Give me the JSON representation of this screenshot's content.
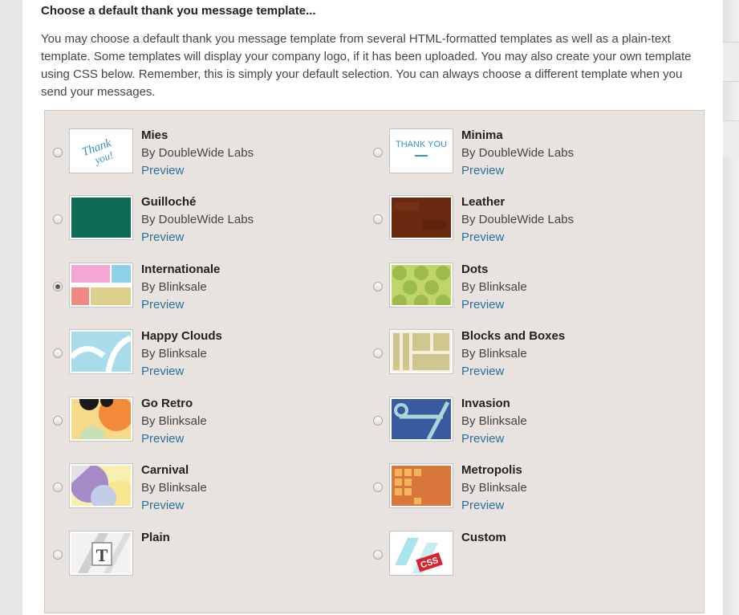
{
  "section": {
    "heading": "Choose a default thank you message template...",
    "description": "You may choose a default thank you message template from several HTML-formatted templates as well as a plain-text template. Some templates will display your company logo, if it has been uploaded. You may also create your own template using CSS below. Remember, this is simply your default selection. You can always choose a different template when you send your messages."
  },
  "templates": [
    {
      "name": "Mies",
      "author": "By DoubleWide Labs",
      "preview": "Preview",
      "selected": false,
      "thumb": "thank-you-script-icon"
    },
    {
      "name": "Minima",
      "author": "By DoubleWide Labs",
      "preview": "Preview",
      "selected": false,
      "thumb": "thank-you-minimal-icon"
    },
    {
      "name": "Guilloché",
      "author": "By DoubleWide Labs",
      "preview": "Preview",
      "selected": false,
      "thumb": "green-pattern-icon"
    },
    {
      "name": "Leather",
      "author": "By DoubleWide Labs",
      "preview": "Preview",
      "selected": false,
      "thumb": "leather-texture-icon"
    },
    {
      "name": "Internationale",
      "author": "By Blinksale",
      "preview": "Preview",
      "selected": true,
      "thumb": "color-blocks-icon"
    },
    {
      "name": "Dots",
      "author": "By Blinksale",
      "preview": "Preview",
      "selected": false,
      "thumb": "dots-pattern-icon"
    },
    {
      "name": "Happy Clouds",
      "author": "By Blinksale",
      "preview": "Preview",
      "selected": false,
      "thumb": "clouds-icon"
    },
    {
      "name": "Blocks and Boxes",
      "author": "By Blinksale",
      "preview": "Preview",
      "selected": false,
      "thumb": "blocks-boxes-icon"
    },
    {
      "name": "Go Retro",
      "author": "By Blinksale",
      "preview": "Preview",
      "selected": false,
      "thumb": "retro-circles-icon"
    },
    {
      "name": "Invasion",
      "author": "By Blinksale",
      "preview": "Preview",
      "selected": false,
      "thumb": "invasion-shapes-icon"
    },
    {
      "name": "Carnival",
      "author": "By Blinksale",
      "preview": "Preview",
      "selected": false,
      "thumb": "carnival-shapes-icon"
    },
    {
      "name": "Metropolis",
      "author": "By Blinksale",
      "preview": "Preview",
      "selected": false,
      "thumb": "metropolis-windows-icon"
    },
    {
      "name": "Plain",
      "author": "",
      "preview": "",
      "selected": false,
      "thumb": "plain-text-icon"
    },
    {
      "name": "Custom",
      "author": "",
      "preview": "",
      "selected": false,
      "thumb": "css-icon"
    }
  ],
  "thumb_text": {
    "minima": "THANK YOU",
    "css": "CSS",
    "plain_t": "T"
  }
}
